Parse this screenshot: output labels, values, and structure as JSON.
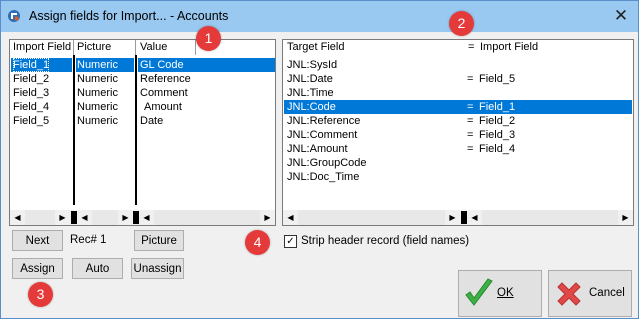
{
  "window": {
    "title": "Assign fields for Import... - Accounts",
    "close_glyph": "✕"
  },
  "left_list": {
    "headers": [
      "Import Field",
      "Picture",
      "Value"
    ],
    "rows": [
      [
        "Field_1",
        "Numeric",
        "GL Code"
      ],
      [
        "Field_2",
        "Numeric",
        "Reference"
      ],
      [
        "Field_3",
        "Numeric",
        "Comment"
      ],
      [
        "Field_4",
        "Numeric",
        "Amount"
      ],
      [
        "Field_5",
        "Numeric",
        "Date"
      ]
    ],
    "selected_index": 0
  },
  "right_list": {
    "headers": [
      "Target Field",
      "=",
      "Import Field"
    ],
    "rows": [
      [
        "JNL:SysId",
        "",
        ""
      ],
      [
        "JNL:Date",
        "=",
        "Field_5"
      ],
      [
        "JNL:Time",
        "",
        ""
      ],
      [
        "JNL:Code",
        "=",
        "Field_1"
      ],
      [
        "JNL:Reference",
        "=",
        "Field_2"
      ],
      [
        "JNL:Comment",
        "=",
        "Field_3"
      ],
      [
        "JNL:Amount",
        "=",
        "Field_4"
      ],
      [
        "JNL:GroupCode",
        "",
        ""
      ],
      [
        "JNL:Doc_Time",
        "",
        ""
      ]
    ],
    "selected_index": 3
  },
  "scroll": {
    "left_glyph": "◀",
    "right_glyph": "▶"
  },
  "buttons": {
    "next": "Next",
    "rec_label": "Rec# 1",
    "picture": "Picture",
    "assign": "Assign",
    "auto": "Auto",
    "unassign": "Unassign",
    "ok": "OK",
    "cancel": "Cancel"
  },
  "checkbox": {
    "label": "Strip header record (field names)",
    "checked": true,
    "check_glyph": "✓"
  },
  "callouts": [
    "1",
    "2",
    "3",
    "4"
  ],
  "colors": {
    "selection": "#0078d7",
    "callout": "#e53a3a",
    "ok_check": "#3cb043",
    "cancel_x": "#e04848"
  }
}
